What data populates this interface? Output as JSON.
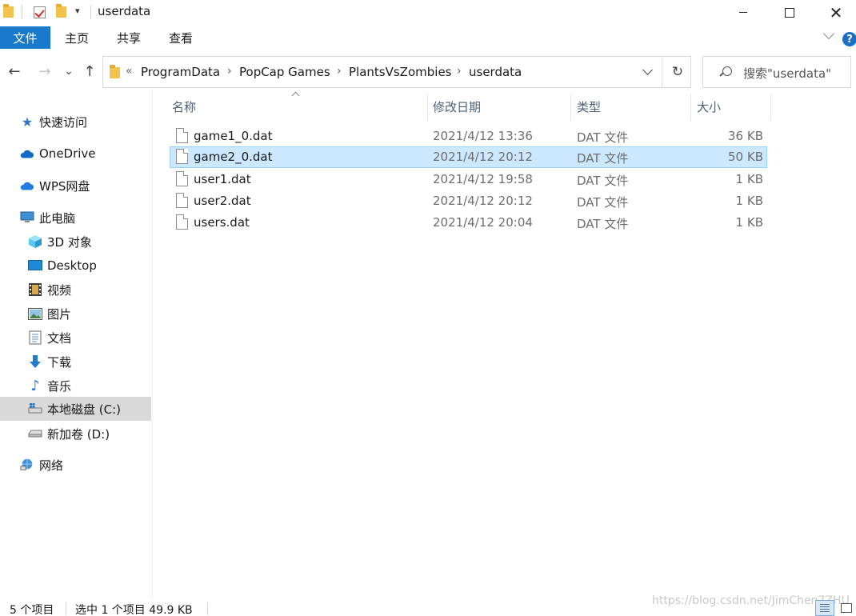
{
  "window": {
    "title": "userdata",
    "minimize_label": "",
    "maximize_label": "",
    "close_label": "✕"
  },
  "ribbon": {
    "file_tab": "文件",
    "tabs": [
      "主页",
      "共享",
      "查看"
    ]
  },
  "nav": {
    "back": "←",
    "forward": "→",
    "recent": "⌄",
    "up": "↑",
    "refresh": "↻",
    "breadcrumb": [
      "ProgramData",
      "PopCap Games",
      "PlantsVsZombies",
      "userdata"
    ],
    "overflow": "«",
    "search_placeholder": "搜索\"userdata\""
  },
  "sidebar": {
    "items": [
      {
        "label": "快速访问",
        "icon": "star-icon"
      },
      {
        "label": "OneDrive",
        "icon": "cloud-icon"
      },
      {
        "label": "WPS网盘",
        "icon": "cloud-icon"
      },
      {
        "label": "此电脑",
        "icon": "computer-icon"
      },
      {
        "label": "3D 对象",
        "icon": "cube-icon"
      },
      {
        "label": "Desktop",
        "icon": "desktop-icon"
      },
      {
        "label": "视频",
        "icon": "film-icon"
      },
      {
        "label": "图片",
        "icon": "picture-icon"
      },
      {
        "label": "文档",
        "icon": "document-icon"
      },
      {
        "label": "下载",
        "icon": "download-icon"
      },
      {
        "label": "音乐",
        "icon": "music-icon"
      },
      {
        "label": "本地磁盘 (C:)",
        "icon": "drive-icon"
      },
      {
        "label": "新加卷 (D:)",
        "icon": "drive-icon"
      },
      {
        "label": "网络",
        "icon": "network-icon"
      }
    ],
    "selected_index": 11
  },
  "filelist": {
    "columns": [
      "名称",
      "修改日期",
      "类型",
      "大小"
    ],
    "rows": [
      {
        "name": "game1_0.dat",
        "date": "2021/4/12 13:36",
        "type": "DAT 文件",
        "size": "36 KB",
        "selected": false
      },
      {
        "name": "game2_0.dat",
        "date": "2021/4/12 20:12",
        "type": "DAT 文件",
        "size": "50 KB",
        "selected": true
      },
      {
        "name": "user1.dat",
        "date": "2021/4/12 19:58",
        "type": "DAT 文件",
        "size": "1 KB",
        "selected": false
      },
      {
        "name": "user2.dat",
        "date": "2021/4/12 20:12",
        "type": "DAT 文件",
        "size": "1 KB",
        "selected": false
      },
      {
        "name": "users.dat",
        "date": "2021/4/12 20:04",
        "type": "DAT 文件",
        "size": "1 KB",
        "selected": false
      }
    ]
  },
  "status": {
    "item_count": "5 个项目",
    "selection": "选中 1 个项目  49.9 KB"
  },
  "watermark": "https://blog.csdn.net/JimChen7ZHU",
  "colors": {
    "accent": "#1979ca",
    "selection_bg": "#cce8ff",
    "selection_border": "#99d1ff",
    "sidebar_selected": "#d9d9d9"
  }
}
